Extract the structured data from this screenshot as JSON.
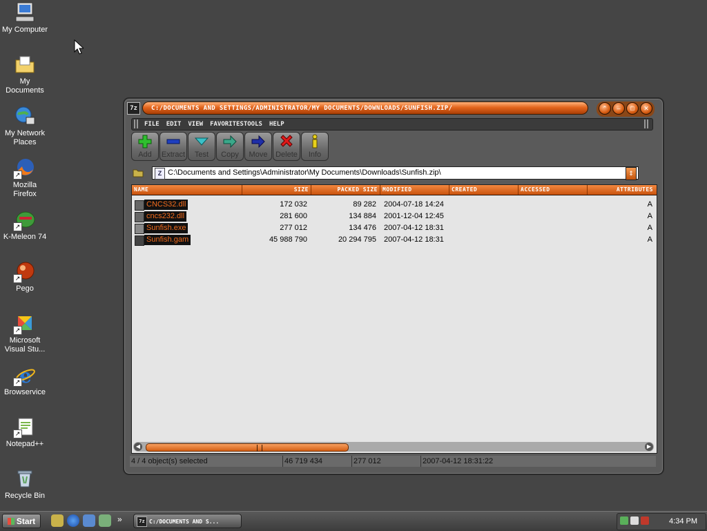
{
  "desktop": {
    "icons": [
      {
        "label": "My Computer",
        "icon": "computer-icon"
      },
      {
        "label": "My Documents",
        "icon": "folder-documents-icon"
      },
      {
        "label": "My Network Places",
        "icon": "network-icon"
      },
      {
        "label": "Mozilla Firefox",
        "icon": "firefox-icon"
      },
      {
        "label": "K-Meleon 74",
        "icon": "kmeleon-icon"
      },
      {
        "label": "Pego",
        "icon": "pego-icon"
      },
      {
        "label": "Microsoft Visual Stu...",
        "icon": "visual-studio-icon"
      },
      {
        "label": "Browservice",
        "icon": "ie-icon"
      },
      {
        "label": "Notepad++",
        "icon": "notepadpp-icon"
      },
      {
        "label": "Recycle Bin",
        "icon": "recycle-bin-icon"
      }
    ]
  },
  "window": {
    "app_icon": "7z",
    "title": "C:/DOCUMENTS AND SETTINGS/ADMINISTRATOR/MY DOCUMENTS/DOWNLOADS/SUNFISH.ZIP/",
    "menu": [
      "FILE",
      "EDIT",
      "VIEW",
      "FAVORITES",
      "TOOLS",
      "HELP"
    ],
    "toolbar": [
      {
        "label": "Add",
        "icon": "plus-icon"
      },
      {
        "label": "Extract",
        "icon": "minus-icon"
      },
      {
        "label": "Test",
        "icon": "check-icon"
      },
      {
        "label": "Copy",
        "icon": "copy-arrow-icon"
      },
      {
        "label": "Move",
        "icon": "move-arrow-icon"
      },
      {
        "label": "Delete",
        "icon": "delete-x-icon"
      },
      {
        "label": "Info",
        "icon": "info-icon"
      }
    ],
    "address": "C:\\Documents and Settings\\Administrator\\My Documents\\Downloads\\Sunfish.zip\\",
    "columns": [
      "NAME",
      "SIZE",
      "PACKED SIZE",
      "MODIFIED",
      "CREATED",
      "ACCESSED",
      "ATTRIBUTES"
    ],
    "files": [
      {
        "name": "CNCS32.dll",
        "size": "172 032",
        "packed": "89 282",
        "modified": "2004-07-18 14:24",
        "created": "",
        "accessed": "",
        "attr": "A"
      },
      {
        "name": "cncs232.dll",
        "size": "281 600",
        "packed": "134 884",
        "modified": "2001-12-04 12:45",
        "created": "",
        "accessed": "",
        "attr": "A"
      },
      {
        "name": "Sunfish.exe",
        "size": "277 012",
        "packed": "134 476",
        "modified": "2007-04-12 18:31",
        "created": "",
        "accessed": "",
        "attr": "A"
      },
      {
        "name": "Sunfish.gam",
        "size": "45 988 790",
        "packed": "20 294 795",
        "modified": "2007-04-12 18:31",
        "created": "",
        "accessed": "",
        "attr": "A"
      }
    ],
    "status": {
      "selected": "4 / 4 object(s) selected",
      "total_size": "46 719 434",
      "selected_size": "277 012",
      "date": "2007-04-12 18:31:22"
    }
  },
  "taskbar": {
    "start_label": "Start",
    "quick_launch": [
      "7zip-icon",
      "ie-icon",
      "desktop-icon",
      "search-icon"
    ],
    "more": "»",
    "task_label": "C:/DOCUMENTS AND S...",
    "tray_icons": [
      "network-tray-icon",
      "usb-tray-icon",
      "security-tray-icon"
    ],
    "clock": "4:34 PM"
  },
  "colors": {
    "accent": "#e3651d",
    "desktop": "#454545",
    "selection_text": "#f26b1c"
  }
}
